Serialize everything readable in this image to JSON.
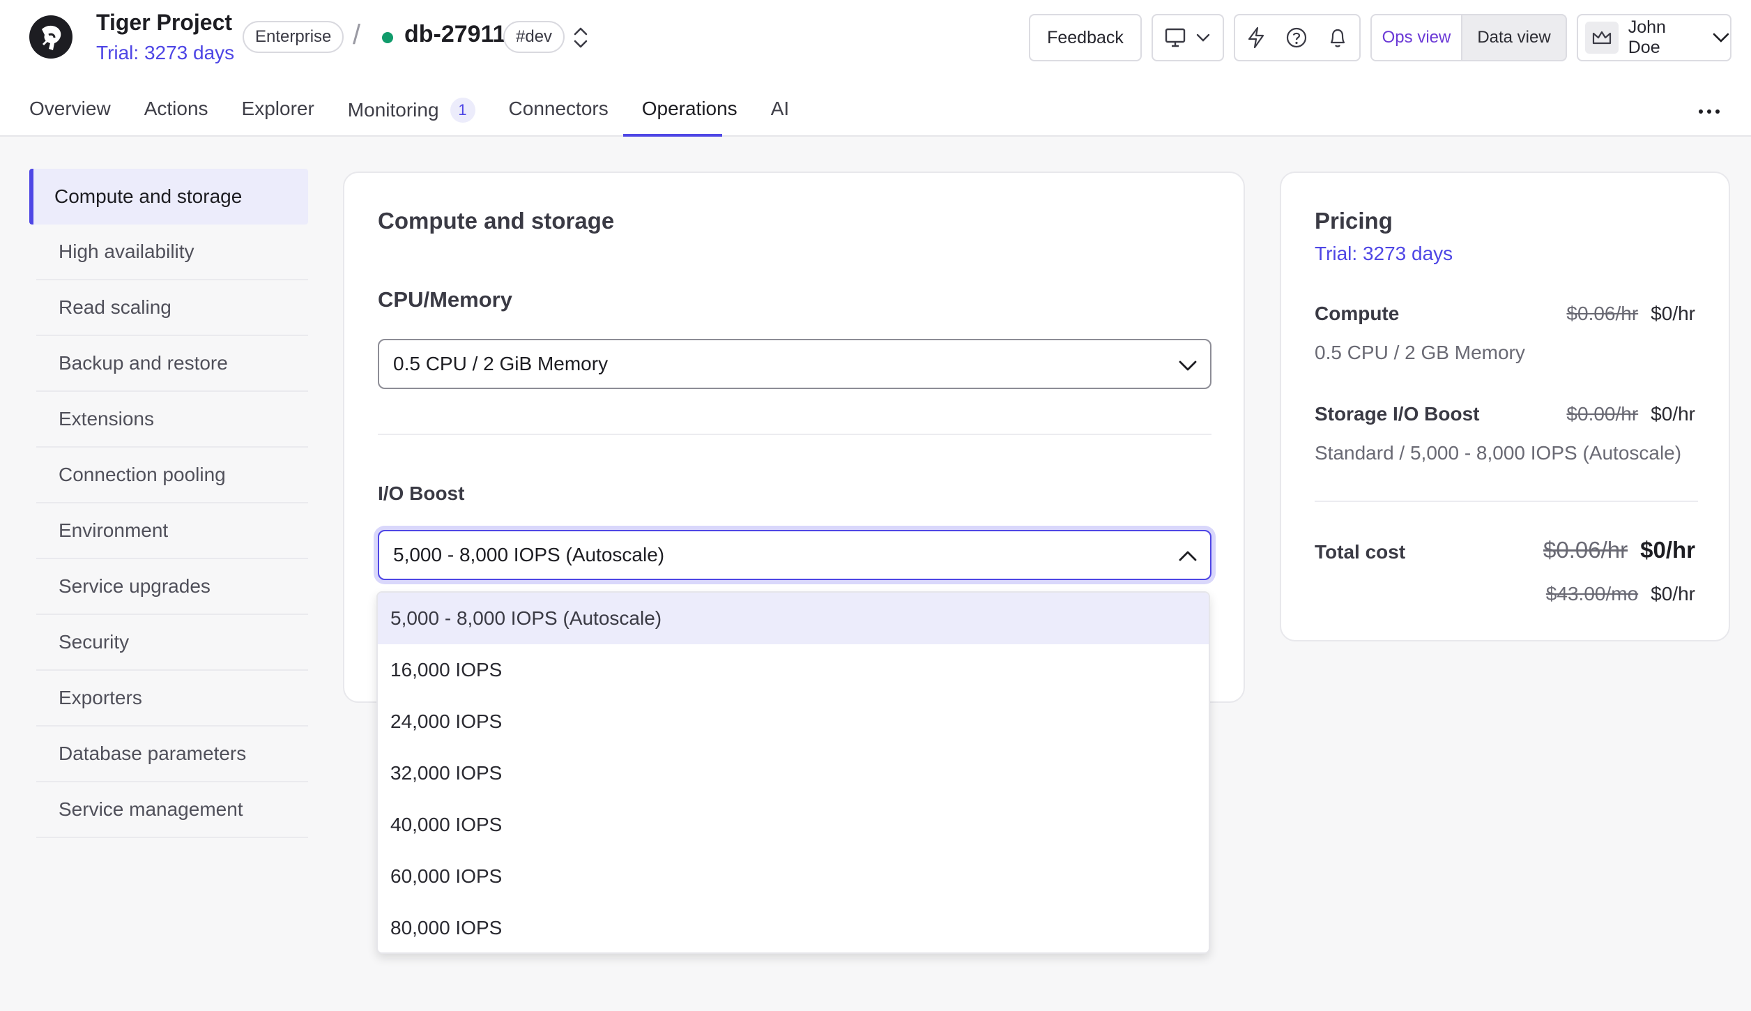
{
  "project": {
    "name": "Tiger Project",
    "trial": "Trial: 3273 days",
    "plan": "Enterprise",
    "service": "db-27911",
    "env_tag": "#dev",
    "status_color": "#109b6b"
  },
  "header_actions": {
    "feedback": "Feedback",
    "ops_view": "Ops view",
    "data_view": "Data view",
    "user_name": "John Doe"
  },
  "tabs": [
    {
      "label": "Overview"
    },
    {
      "label": "Actions"
    },
    {
      "label": "Explorer"
    },
    {
      "label": "Monitoring",
      "badge": "1"
    },
    {
      "label": "Connectors"
    },
    {
      "label": "Operations"
    },
    {
      "label": "AI"
    }
  ],
  "sidebar": {
    "items": [
      {
        "label": "Compute and storage"
      },
      {
        "label": "High availability"
      },
      {
        "label": "Read scaling"
      },
      {
        "label": "Backup and restore"
      },
      {
        "label": "Extensions"
      },
      {
        "label": "Connection pooling"
      },
      {
        "label": "Environment"
      },
      {
        "label": "Service upgrades"
      },
      {
        "label": "Security"
      },
      {
        "label": "Exporters"
      },
      {
        "label": "Database parameters"
      },
      {
        "label": "Service management"
      }
    ]
  },
  "main": {
    "title": "Compute and storage",
    "cpu_label": "CPU/Memory",
    "cpu_value": "0.5 CPU / 2 GiB Memory",
    "io_label": "I/O Boost",
    "io_value": "5,000 - 8,000 IOPS (Autoscale)",
    "io_options": [
      "5,000 - 8,000 IOPS (Autoscale)",
      "16,000 IOPS",
      "24,000 IOPS",
      "32,000 IOPS",
      "40,000 IOPS",
      "60,000 IOPS",
      "80,000 IOPS"
    ]
  },
  "pricing": {
    "title": "Pricing",
    "trial": "Trial: 3273 days",
    "compute_label": "Compute",
    "compute_old": "$0.06/hr",
    "compute_new": "$0/hr",
    "compute_desc": "0.5 CPU / 2 GB Memory",
    "storage_label": "Storage I/O Boost",
    "storage_old": "$0.00/hr",
    "storage_new": "$0/hr",
    "storage_desc": "Standard / 5,000 - 8,000 IOPS (Autoscale)",
    "total_label": "Total cost",
    "total_old_hr": "$0.06/hr",
    "total_new_hr": "$0/hr",
    "total_old_mo": "$43.00/mo",
    "total_new_mo": "$0/hr"
  },
  "icons": {
    "logo": "tiger-logo-icon",
    "switch": "chevron-up-down-icon",
    "display": "monitor-icon",
    "bolt": "lightning-icon",
    "help": "question-circle-icon",
    "bell": "bell-icon",
    "crown": "crown-icon",
    "more": "more-horizontal-icon"
  },
  "colors": {
    "accent": "#4e46e5",
    "ops_view": "#6b39d6"
  }
}
